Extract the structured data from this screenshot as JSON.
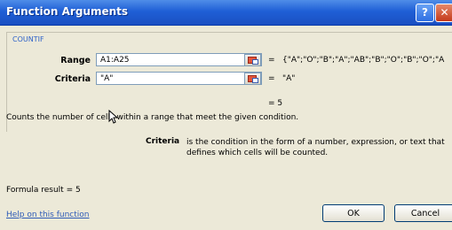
{
  "window": {
    "title": "Function Arguments",
    "help_glyph": "?",
    "close_glyph": "✕"
  },
  "function_group": {
    "name": "COUNTIF"
  },
  "arguments": {
    "range": {
      "label": "Range",
      "value": "A1:A25",
      "eq": "=",
      "evaluated": "{\"A\";\"O\";\"B\";\"A\";\"AB\";\"B\";\"O\";\"B\";\"O\";\"A"
    },
    "criteria": {
      "label": "Criteria",
      "value": "\"A\"",
      "eq": "=",
      "evaluated": "\"A\""
    }
  },
  "function_result": "= 5",
  "description": "Counts the number of cells within a range that meet the given condition.",
  "argument_help": {
    "label": "Criteria",
    "text": "is the condition in the form of a number, expression, or text that defines which cells will be counted."
  },
  "formula_result": "Formula result =   5",
  "help_link": "Help on this function",
  "buttons": {
    "ok": "OK",
    "cancel": "Cancel"
  },
  "icons": {
    "help": "help-icon",
    "close": "close-icon",
    "collapse_dialog": "collapse-dialog-icon",
    "cursor": "mouse-cursor-icon"
  }
}
